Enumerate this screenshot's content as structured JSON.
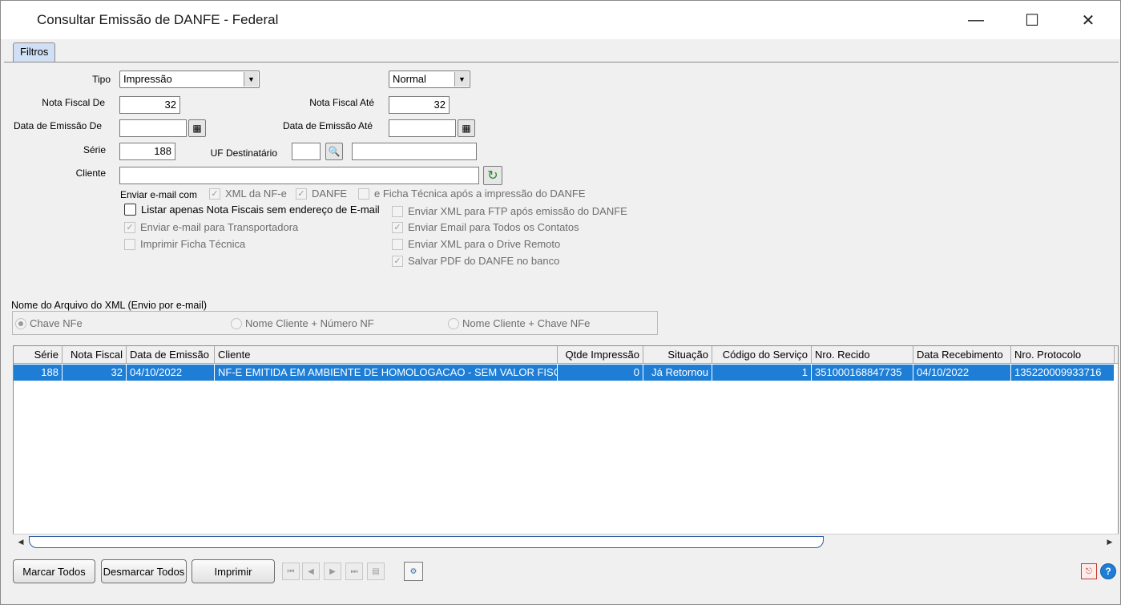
{
  "window": {
    "title": "Consultar Emissão de DANFE - Federal",
    "minimize": "—",
    "maximize": "☐",
    "close": "✕"
  },
  "tabs": [
    "Filtros"
  ],
  "form": {
    "tipo_label": "Tipo",
    "tipo_value": "Impressão",
    "modo_value": "Normal",
    "nf_de_label": "Nota Fiscal De",
    "nf_de_value": "32",
    "nf_ate_label": "Nota Fiscal Até",
    "nf_ate_value": "32",
    "data_de_label": "Data de Emissão De",
    "data_de_value": "",
    "data_ate_label": "Data de Emissão Até",
    "data_ate_value": "",
    "serie_label": "Série",
    "serie_value": "188",
    "uf_label": "UF Destinatário",
    "uf_value": "",
    "uf_name_value": "",
    "cliente_label": "Cliente",
    "cliente_value": "",
    "enviar_label": "Enviar e-mail com"
  },
  "checks": {
    "xml_nfe": "XML da NF-e",
    "danfe": "DANFE",
    "ficha": "e Ficha Técnica após a impressão do DANFE",
    "listar": "Listar apenas Nota Fiscais sem endereço de E-mail",
    "transportadora": "Enviar e-mail para Transportadora",
    "imprimir_ficha": "Imprimir Ficha Técnica",
    "ftp": "Enviar XML para FTP após emissão do DANFE",
    "todos_contatos": "Enviar Email para Todos os Contatos",
    "drive": "Enviar XML para o Drive Remoto",
    "salvar_pdf": "Salvar PDF do DANFE no banco",
    "checkmark": "✓"
  },
  "xml_group": {
    "title": "Nome do Arquivo do XML (Envio por e-mail)",
    "options": [
      "Chave NFe",
      "Nome Cliente + Número NF",
      "Nome Cliente + Chave NFe"
    ]
  },
  "grid": {
    "headers": [
      "Série",
      "Nota Fiscal",
      "Data de Emissão",
      "Cliente",
      "Qtde Impressão",
      "Situação",
      "Código do Serviço",
      "Nro. Recido",
      "Data Recebimento",
      "Nro. Protocolo"
    ],
    "rows": [
      [
        "188",
        "32",
        "04/10/2022",
        "NF-E EMITIDA EM AMBIENTE DE HOMOLOGACAO - SEM VALOR FISCAL",
        "0",
        "Já Retornou",
        "1",
        "351000168847735",
        "04/10/2022",
        "135220009933716"
      ]
    ]
  },
  "buttons": {
    "marcar": "Marcar Todos",
    "desmarcar": "Desmarcar Todos",
    "imprimir": "Imprimir"
  },
  "colors": {
    "selection": "#1e7ed6",
    "tab": "#cfe0f4"
  }
}
